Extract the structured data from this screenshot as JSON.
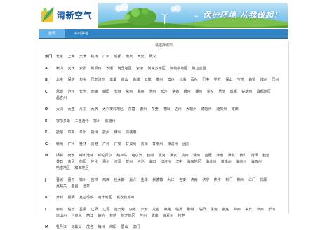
{
  "header": {
    "logo_text": "清新空气",
    "banner_slogan": "保护环境 从我做起！"
  },
  "nav": {
    "tabs": [
      {
        "label": "首页",
        "active": true
      },
      {
        "label": "实时排名",
        "active": false
      }
    ]
  },
  "panel": {
    "title": "请选择城市"
  },
  "groups": [
    {
      "letter": "热门",
      "cities": [
        "北京",
        "上海",
        "天津",
        "杭州",
        "广州",
        "成都",
        "南京",
        "西安",
        "武汉"
      ]
    },
    {
      "letter": "A",
      "cities": [
        "鞍山",
        "安庆",
        "安阳",
        "阿坝州",
        "安顺",
        "阿里地区",
        "安康",
        "阿克苏地区",
        "阿勒泰地区",
        "阿拉善盟"
      ]
    },
    {
      "letter": "B",
      "cities": [
        "北京",
        "保定",
        "包头",
        "巴彦淖尔",
        "本溪",
        "白山",
        "白城",
        "蚌埠",
        "亳州",
        "滨州",
        "北海",
        "百色",
        "巴中",
        "毕节",
        "保山",
        "宝鸡",
        "白银",
        "博州",
        "巴州"
      ]
    },
    {
      "letter": "C",
      "cities": [
        "承德",
        "沧州",
        "长治",
        "赤峰",
        "朝阳",
        "长春",
        "常州",
        "滁州",
        "池州",
        "长沙",
        "常德",
        "郴州",
        "潮州",
        "崇左",
        "重庆",
        "成都",
        "楚雄州",
        "昌都地区",
        "昌吉州"
      ]
    },
    {
      "letter": "D",
      "cities": [
        "大同",
        "大连",
        "丹东",
        "大庆",
        "大兴安岭地区",
        "东营",
        "德州",
        "东莞",
        "德阳",
        "达州",
        "大理州",
        "德宏州",
        "迪庆州",
        "定西"
      ]
    },
    {
      "letter": "E",
      "cities": [
        "鄂尔多斯",
        "二连浩特",
        "鄂州",
        "恩施州"
      ]
    },
    {
      "letter": "F",
      "cities": [
        "抚顺",
        "阜新",
        "阜阳",
        "福州",
        "抚州",
        "佛山",
        "防城港"
      ]
    },
    {
      "letter": "G",
      "cities": [
        "赣州",
        "广州",
        "桂林",
        "贵港",
        "广元",
        "广安",
        "甘孜州",
        "贵阳",
        "甘南州",
        "果洛州",
        "固原"
      ]
    },
    {
      "letter": "H",
      "cities": [
        "邯郸",
        "衡水",
        "呼和浩特",
        "呼伦贝尔",
        "葫芦岛",
        "哈尔滨",
        "鹤岗",
        "黑河",
        "淮安",
        "杭州",
        "湖州",
        "合肥",
        "淮南",
        "淮北",
        "黄山",
        "菏泽",
        "鹤壁",
        "黄石",
        "黄冈",
        "衡阳",
        "怀化",
        "惠州",
        "河源",
        "贺州",
        "河池",
        "海口",
        "红河州",
        "汉中",
        "海东地区",
        "海北州",
        "黄南州",
        "海南州",
        "海西州",
        "哈密地区",
        "和田地区"
      ]
    },
    {
      "letter": "J",
      "cities": [
        "晋城",
        "晋中",
        "锦州",
        "吉林",
        "鸡西",
        "佳木斯",
        "嘉兴",
        "金华",
        "景德镇",
        "九江",
        "吉安",
        "济南",
        "济宁",
        "焦作",
        "荆门",
        "荆州",
        "江门",
        "揭阳",
        "嘉峪关",
        "金昌",
        "酒泉"
      ]
    },
    {
      "letter": "K",
      "cities": [
        "开封",
        "昆明",
        "克拉玛依",
        "喀什地区",
        "克孜勒苏州"
      ]
    },
    {
      "letter": "L",
      "cities": [
        "廊坊",
        "临汾",
        "吕梁",
        "辽阳",
        "辽源",
        "连云港",
        "丽水",
        "六安",
        "龙岩",
        "莱芜",
        "临沂",
        "聊城",
        "洛阳",
        "漯河",
        "娄底",
        "柳州",
        "来宾",
        "泸州",
        "乐山",
        "凉山州",
        "六盘水",
        "丽江",
        "临沧",
        "拉萨",
        "林芝地区",
        "兰州",
        "陇南",
        "临夏州",
        "拉萨"
      ]
    },
    {
      "letter": "M",
      "cities": [
        "牡丹江",
        "马鞍山",
        "茂名",
        "梅州",
        "绵阳",
        "眉山",
        "澳门"
      ]
    }
  ]
}
